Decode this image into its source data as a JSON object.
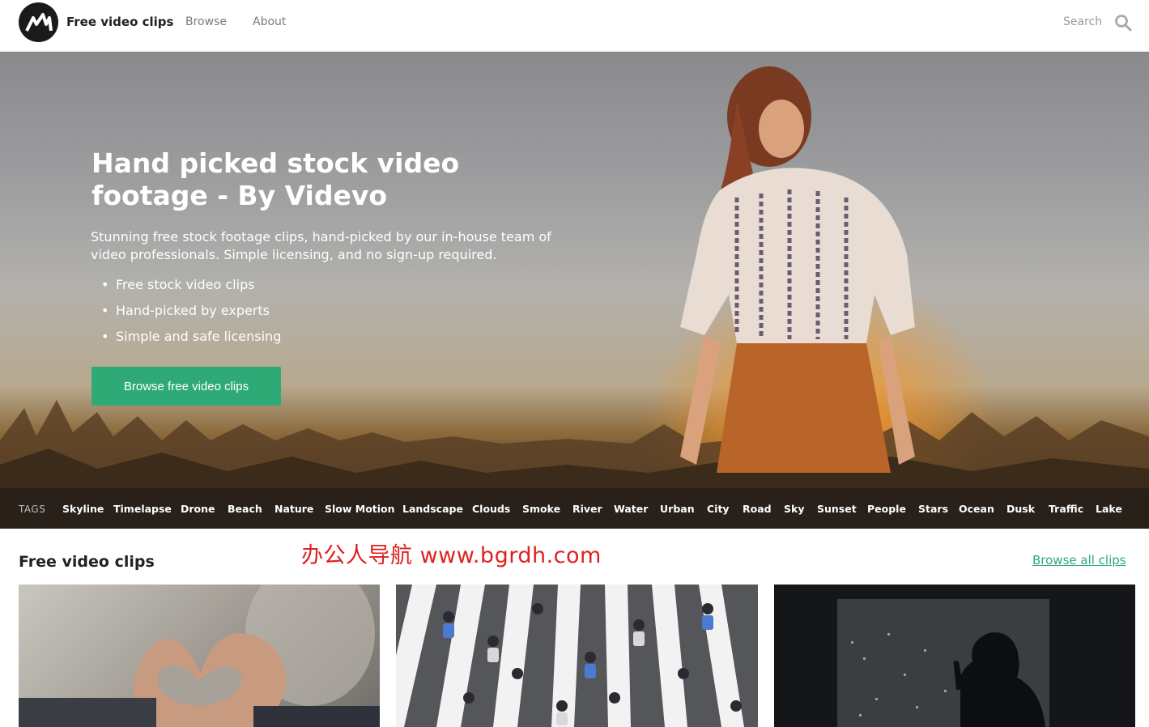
{
  "nav": {
    "brand": "Free video clips",
    "links": [
      "Browse",
      "About"
    ],
    "search_label": "Search"
  },
  "hero": {
    "title": "Hand picked stock video footage - By Videvo",
    "lead": "Stunning free stock footage clips, hand-picked by our in-house team of video professionals. Simple licensing, and no sign-up required.",
    "bullets": [
      "Free stock video clips",
      "Hand-picked by experts",
      "Simple and safe licensing"
    ],
    "cta": "Browse free video clips"
  },
  "tags": {
    "label": "TAGS",
    "items": [
      "Skyline",
      "Timelapse",
      "Drone",
      "Beach",
      "Nature",
      "Slow Motion",
      "Landscape",
      "Clouds",
      "Smoke",
      "River",
      "Water",
      "Urban",
      "City",
      "Road",
      "Sky",
      "Sunset",
      "People",
      "Stars",
      "Ocean",
      "Dusk",
      "Traffic",
      "Lake"
    ]
  },
  "section": {
    "title": "Free video clips",
    "browse_all": "Browse all clips",
    "watermark": "办公人导航  www.bgrdh.com"
  },
  "colors": {
    "accent": "#2eaa77",
    "watermark": "#e02020"
  }
}
